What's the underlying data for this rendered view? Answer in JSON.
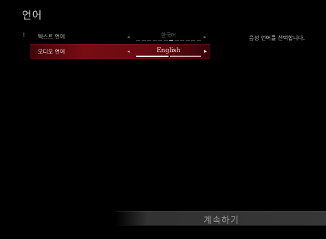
{
  "header": {
    "title": "언어"
  },
  "marker": "!",
  "settings": [
    {
      "label": "텍스트 언어",
      "value": "한국어",
      "left_arrow": "◂",
      "right_arrow": "▸"
    },
    {
      "label": "오디오 언어",
      "value": "English",
      "left_arrow": "◂",
      "right_arrow": "▸",
      "progress": 0.5
    }
  ],
  "description": "음성 언어를 선택합니다.",
  "footer": {
    "continue_label": "계속하기"
  },
  "colors": {
    "background": "#000000",
    "selected_row": "#7d0e14",
    "continue_bg": "#3a3a3a"
  }
}
